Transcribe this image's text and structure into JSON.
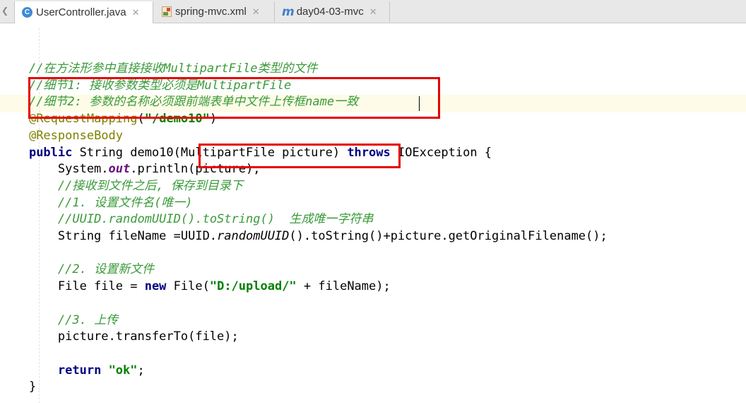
{
  "tabs": [
    {
      "label": "UserController.java",
      "icon": "java-class-icon",
      "active": true
    },
    {
      "label": "spring-mvc.xml",
      "icon": "xml-file-icon",
      "active": false
    },
    {
      "label": "day04-03-mvc",
      "icon": "maven-module-icon",
      "active": false
    }
  ],
  "code_lines": [
    [
      {
        "t": "    ",
        "c": ""
      },
      {
        "t": "//在方法形参中直接接收MultipartFile类型的文件",
        "c": "c"
      }
    ],
    [
      {
        "t": "    ",
        "c": ""
      },
      {
        "t": "//细节1: 接收参数类型必须是MultipartFile",
        "c": "c"
      }
    ],
    [
      {
        "t": "    ",
        "c": ""
      },
      {
        "t": "//细节2: 参数的名称必须跟前端表单中文件上传框name一致",
        "c": "c"
      }
    ],
    [
      {
        "t": "    ",
        "c": ""
      },
      {
        "t": "@RequestMapping",
        "c": "a"
      },
      {
        "t": "(",
        "c": ""
      },
      {
        "t": "\"/demo10\"",
        "c": "s"
      },
      {
        "t": ")",
        "c": ""
      }
    ],
    [
      {
        "t": "    ",
        "c": ""
      },
      {
        "t": "@ResponseBody",
        "c": "a"
      }
    ],
    [
      {
        "t": "    ",
        "c": ""
      },
      {
        "t": "public",
        "c": "k"
      },
      {
        "t": " String demo10(MultipartFile picture) ",
        "c": ""
      },
      {
        "t": "throws",
        "c": "k"
      },
      {
        "t": " IOException {",
        "c": ""
      }
    ],
    [
      {
        "t": "        System.",
        "c": ""
      },
      {
        "t": "out",
        "c": "f"
      },
      {
        "t": ".println(picture);",
        "c": ""
      }
    ],
    [
      {
        "t": "        ",
        "c": ""
      },
      {
        "t": "//接收到文件之后, 保存到目录下",
        "c": "c"
      }
    ],
    [
      {
        "t": "        ",
        "c": ""
      },
      {
        "t": "//1. 设置文件名(唯一)",
        "c": "c"
      }
    ],
    [
      {
        "t": "        ",
        "c": ""
      },
      {
        "t": "//UUID.randomUUID().toString()  生成唯一字符串",
        "c": "c"
      }
    ],
    [
      {
        "t": "        String fileName =UUID.",
        "c": ""
      },
      {
        "t": "randomUUID",
        "c": "st"
      },
      {
        "t": "().toString()+picture.getOriginalFilename();",
        "c": ""
      }
    ],
    [],
    [
      {
        "t": "        ",
        "c": ""
      },
      {
        "t": "//2. 设置新文件",
        "c": "c"
      }
    ],
    [
      {
        "t": "        File file = ",
        "c": ""
      },
      {
        "t": "new",
        "c": "k"
      },
      {
        "t": " File(",
        "c": ""
      },
      {
        "t": "\"D:/upload/\"",
        "c": "s"
      },
      {
        "t": " + fileName);",
        "c": ""
      }
    ],
    [],
    [
      {
        "t": "        ",
        "c": ""
      },
      {
        "t": "//3. 上传",
        "c": "c"
      }
    ],
    [
      {
        "t": "        picture.transferTo(file);",
        "c": ""
      }
    ],
    [],
    [
      {
        "t": "        ",
        "c": ""
      },
      {
        "t": "return",
        "c": "k"
      },
      {
        "t": " ",
        "c": ""
      },
      {
        "t": "\"ok\"",
        "c": "s"
      },
      {
        "t": ";",
        "c": ""
      }
    ],
    [
      {
        "t": "    }",
        "c": ""
      }
    ]
  ]
}
